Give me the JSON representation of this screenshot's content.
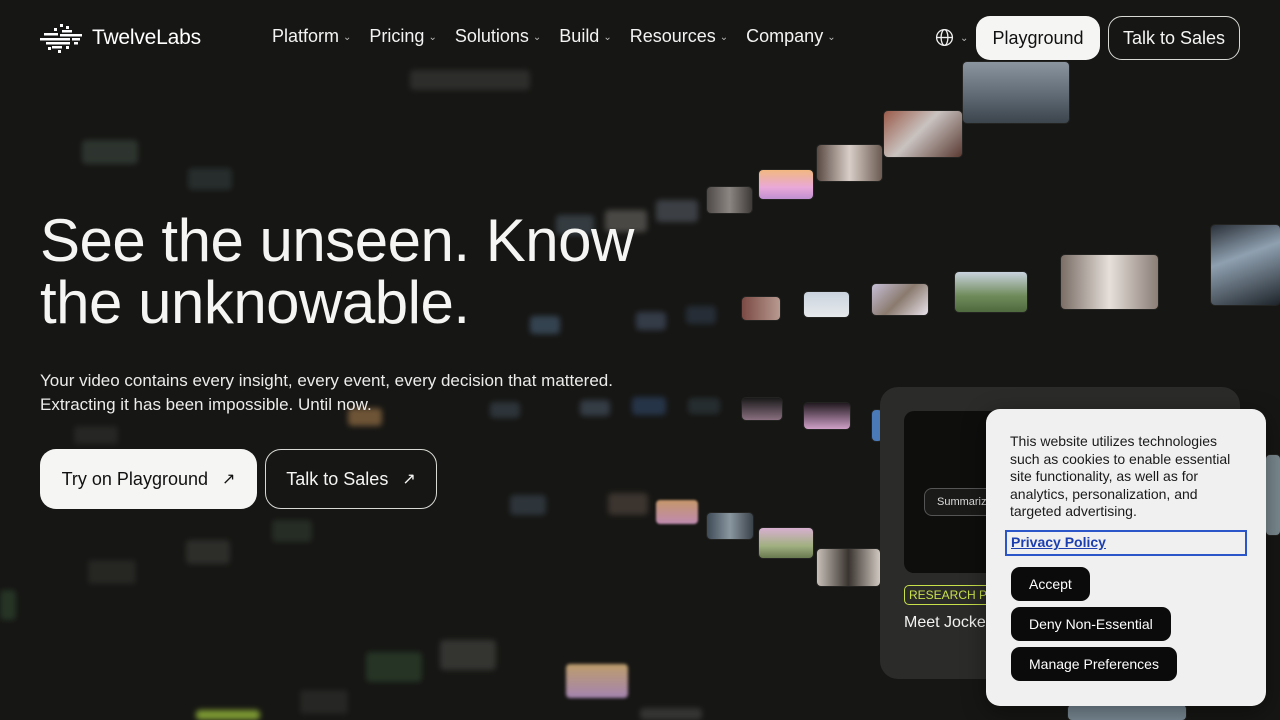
{
  "header": {
    "logo_text": "TwelveLabs",
    "nav": [
      {
        "label": "Platform"
      },
      {
        "label": "Pricing"
      },
      {
        "label": "Solutions"
      },
      {
        "label": "Build"
      },
      {
        "label": "Resources"
      },
      {
        "label": "Company"
      }
    ],
    "language_icon": "globe-icon",
    "playground_label": "Playground",
    "talk_to_sales_label": "Talk to Sales"
  },
  "hero": {
    "title": "See the unseen. Know the unknowable.",
    "subtitle_line1": "Your video contains every insight, every event, every decision that mattered.",
    "subtitle_line2": "Extracting it has been impossible. Until now.",
    "cta_primary": "Try on Playground",
    "cta_secondary": "Talk to Sales"
  },
  "research_card": {
    "pill": "Summarize",
    "badge": "RESEARCH PAPER",
    "title": "Meet Jockey agent"
  },
  "cookie_banner": {
    "text": "This website utilizes technologies such as cookies to enable essential site functionality, as well as for analytics, personalization, and targeted advertising.",
    "privacy_link": "Privacy Policy",
    "accept": "Accept",
    "deny": "Deny Non-Essential",
    "manage": "Manage Preferences"
  },
  "colors": {
    "background": "#161614",
    "accent_badge": "#c8e04a",
    "link": "#1c3fb0"
  }
}
